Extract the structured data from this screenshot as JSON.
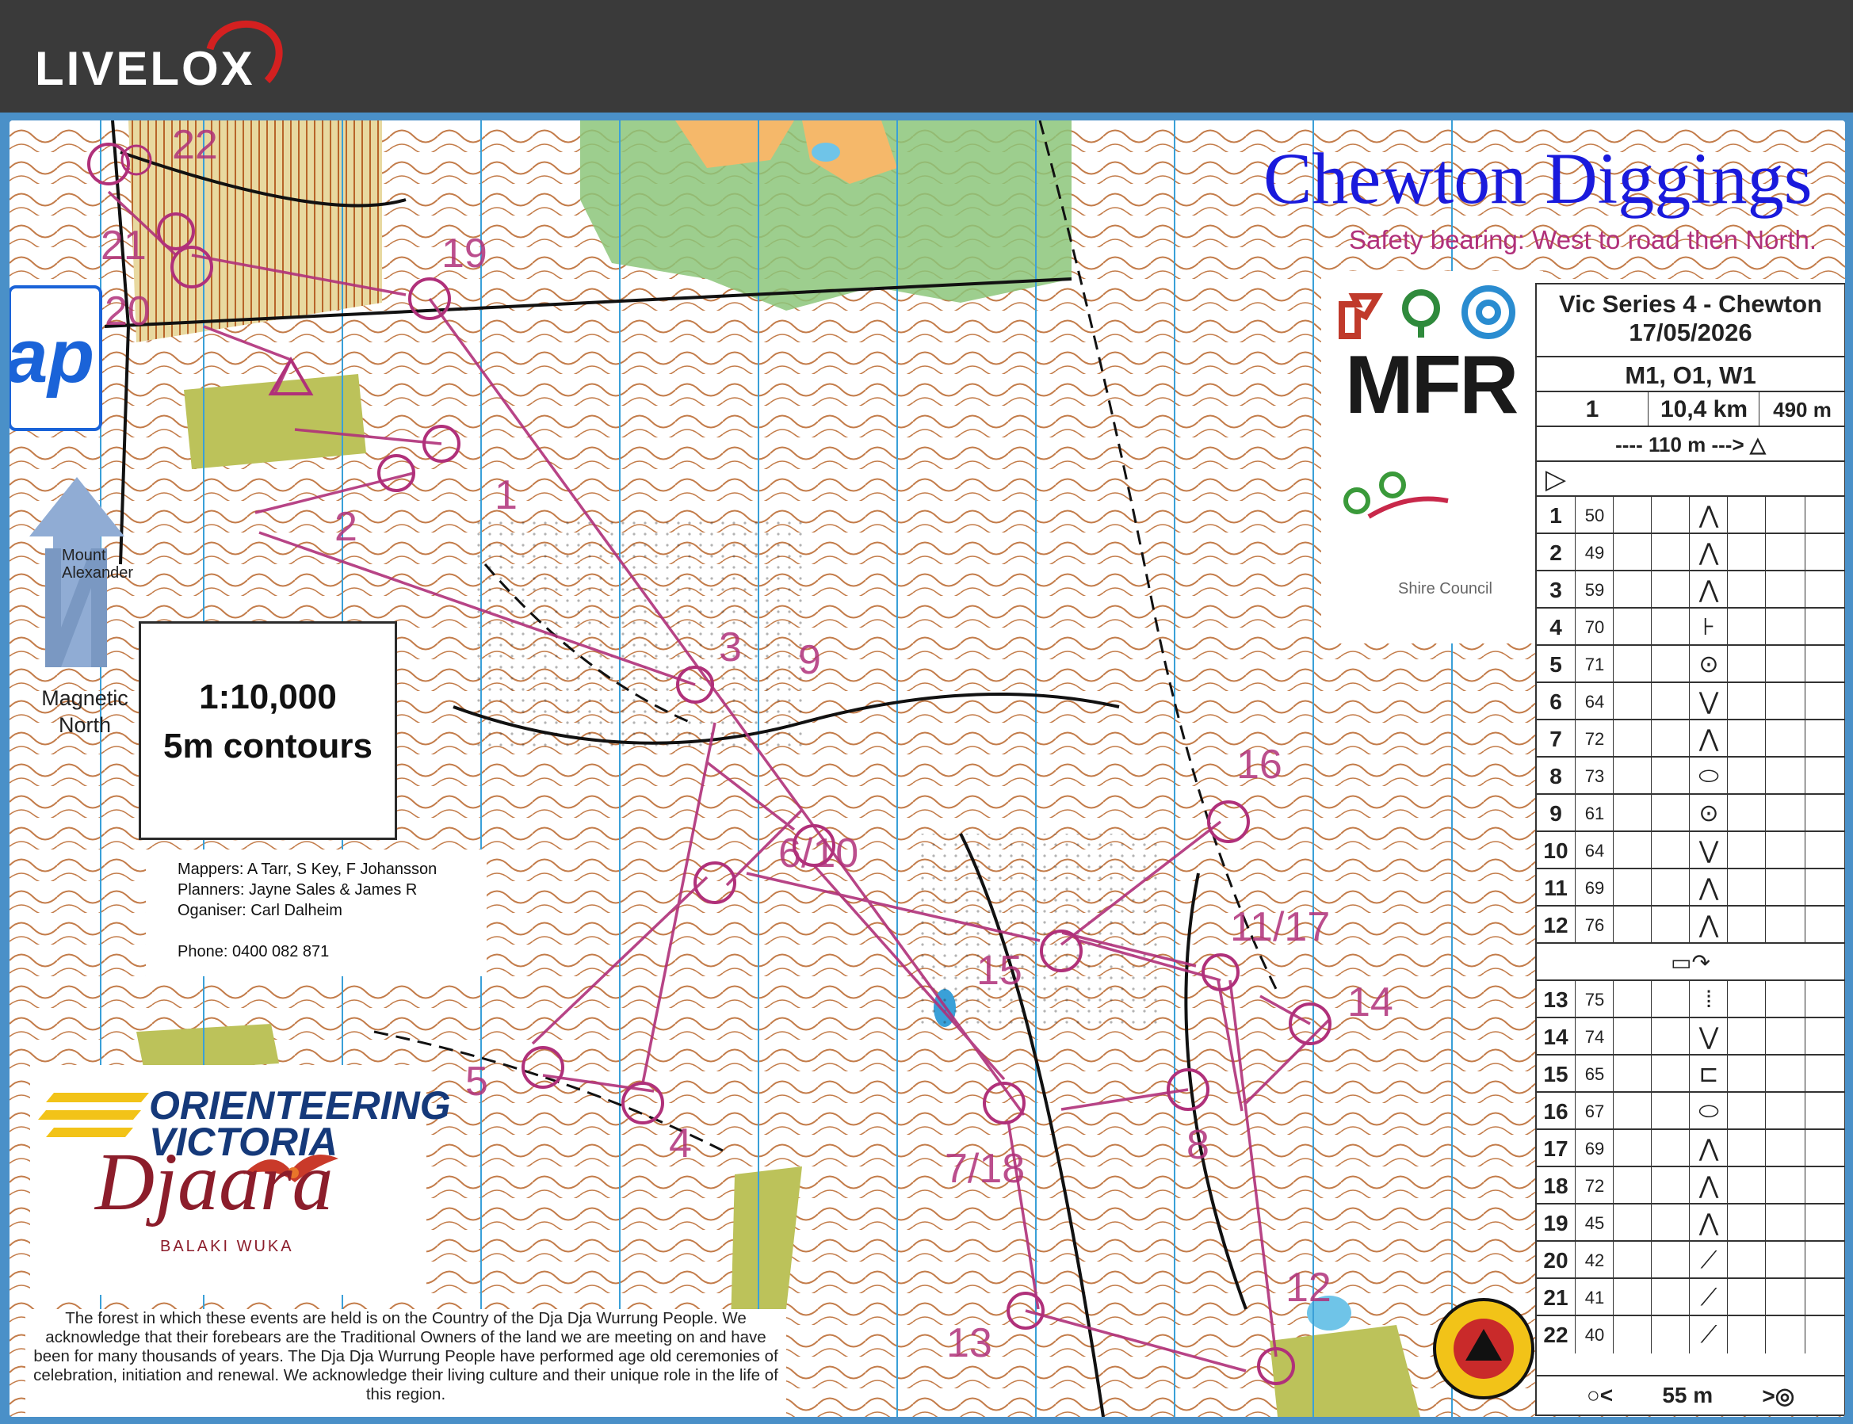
{
  "app": {
    "name": "LIVELOX"
  },
  "map": {
    "title": "Chewton Diggings",
    "safety_bearing": "Safety bearing: West to road then North.",
    "scale": "1:10,000",
    "contours": "5m contours",
    "north_label_line1": "Magnetic",
    "north_label_line2": "North",
    "side_tab": "ap",
    "credits": {
      "mappers": "Mappers: A Tarr, S Key, F Johansson",
      "planners": "Planners: Jayne Sales & James R",
      "organiser": "Oganiser: Carl Dalheim",
      "phone": "Phone: 0400 082 871"
    },
    "sponsors": {
      "mfr": "MFR",
      "council_line1": "Mount",
      "council_line2": "Alexander",
      "council_line3": "Shire Council",
      "ov_line1": "ORIENTEERING",
      "ov_line2": "VICTORIA",
      "djaara": "Djaara",
      "djaara_sub": "BALAKI WUKA"
    },
    "acknowledgement": "The forest in which these events are held is on the Country of the Dja Dja Wurrung People. We acknowledge that their forebears are the Traditional Owners of the land we are meeting on and have been for many thousands of years. The Dja Dja Wurrung People have performed age old ceremonies of celebration, initiation and renewal. We acknowledge their living culture and their unique role in the life of this region.",
    "control_labels": [
      "1",
      "2",
      "3",
      "4",
      "5",
      "6/10",
      "7/18",
      "8",
      "9",
      "11/17",
      "12",
      "13",
      "14",
      "15",
      "16",
      "19",
      "20",
      "21",
      "22"
    ]
  },
  "control_card": {
    "event": "Vic Series 4 - Chewton",
    "date": "17/05/2026",
    "classes": "M1, O1, W1",
    "course_no": "1",
    "length": "10,4 km",
    "climb": "490 m",
    "start_note": "---- 110 m --->",
    "finish_note": "55 m",
    "controls": [
      {
        "num": "1",
        "code": "50"
      },
      {
        "num": "2",
        "code": "49"
      },
      {
        "num": "3",
        "code": "59"
      },
      {
        "num": "4",
        "code": "70"
      },
      {
        "num": "5",
        "code": "71"
      },
      {
        "num": "6",
        "code": "64"
      },
      {
        "num": "7",
        "code": "72"
      },
      {
        "num": "8",
        "code": "73"
      },
      {
        "num": "9",
        "code": "61"
      },
      {
        "num": "10",
        "code": "64"
      },
      {
        "num": "11",
        "code": "69"
      },
      {
        "num": "12",
        "code": "76"
      },
      {
        "num": "13",
        "code": "75"
      },
      {
        "num": "14",
        "code": "74"
      },
      {
        "num": "15",
        "code": "65"
      },
      {
        "num": "16",
        "code": "67"
      },
      {
        "num": "17",
        "code": "69"
      },
      {
        "num": "18",
        "code": "72"
      },
      {
        "num": "19",
        "code": "45"
      },
      {
        "num": "20",
        "code": "42"
      },
      {
        "num": "21",
        "code": "41"
      },
      {
        "num": "22",
        "code": "40"
      }
    ],
    "symbols": [
      "⋀",
      "⋀",
      "⋀",
      "⊦",
      "⊙",
      "⋁",
      "⋀",
      "⬭",
      "⊙",
      "⋁",
      "⋀",
      "⋀",
      "⁞",
      "⋁",
      "⊏",
      "⬭",
      "⋀",
      "⋀",
      "⋀",
      "⟋",
      "⟋",
      "⟋"
    ]
  },
  "colors": {
    "course": "#b0307a",
    "title": "#1a1adc",
    "frame": "#4a90c8",
    "topbar": "#3a3a3a"
  }
}
